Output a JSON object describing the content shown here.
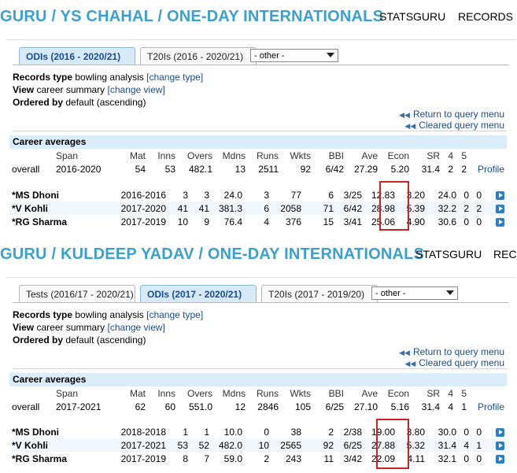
{
  "sections": [
    {
      "header": {
        "title": "GURU / YS CHAHAL / ONE-DAY INTERNATIONALS",
        "nav": [
          "STATSGURU",
          "RECORDS"
        ]
      },
      "tabs": [
        {
          "label": "ODIs (2016 - 2020/21)",
          "active": true
        },
        {
          "label": "T20Is (2016 - 2020/21)",
          "active": false
        }
      ],
      "select": "- other -",
      "records_type": {
        "label": "Records type",
        "value": "bowling analysis",
        "link": "[change type]"
      },
      "view": {
        "label": "View",
        "value": "career summary",
        "link": "[change view]"
      },
      "ordered": {
        "label": "Ordered by",
        "value": "default (ascending)"
      },
      "query_links": [
        "Return to query menu",
        "Cleared query menu"
      ],
      "career_title": "Career averages",
      "columns": [
        "Span",
        "Mat",
        "Inns",
        "Overs",
        "Mdns",
        "Runs",
        "Wkts",
        "BBI",
        "Ave",
        "Econ",
        "SR",
        "4",
        "5"
      ],
      "overall": [
        "overall",
        "2016-2020",
        "54",
        "53",
        "482.1",
        "13",
        "2511",
        "92",
        "6/42",
        "27.29",
        "5.20",
        "31.4",
        "2",
        "2"
      ],
      "profile": "Profile",
      "rows": [
        [
          "*MS Dhoni",
          "2016-2016",
          "3",
          "3",
          "24.0",
          "3",
          "77",
          "6",
          "3/25",
          "12.83",
          "3.20",
          "24.0",
          "0",
          "0"
        ],
        [
          "*V Kohli",
          "2017-2020",
          "41",
          "41",
          "381.3",
          "6",
          "2058",
          "71",
          "6/42",
          "28.98",
          "5.39",
          "32.2",
          "2",
          "2"
        ],
        [
          "*RG Sharma",
          "2017-2019",
          "10",
          "9",
          "76.4",
          "4",
          "376",
          "15",
          "3/41",
          "25.06",
          "4.90",
          "30.6",
          "0",
          "0"
        ]
      ]
    },
    {
      "header": {
        "title": "GURU / KULDEEP YADAV / ONE-DAY INTERNATIONALS",
        "nav": [
          "STATSGURU",
          "RECO"
        ]
      },
      "tabs": [
        {
          "label": "Tests (2016/17 - 2020/21)",
          "active": false
        },
        {
          "label": "ODIs (2017 - 2020/21)",
          "active": true
        },
        {
          "label": "T20Is (2017 - 2019/20)",
          "active": false
        }
      ],
      "select": "- other -",
      "records_type": {
        "label": "Records type",
        "value": "bowling analysis",
        "link": "[change type]"
      },
      "view": {
        "label": "View",
        "value": "career summary",
        "link": "[change view]"
      },
      "ordered": {
        "label": "Ordered by",
        "value": "default (ascending)"
      },
      "query_links": [
        "Return to query menu",
        "Cleared query menu"
      ],
      "career_title": "Career averages",
      "columns": [
        "Span",
        "Mat",
        "Inns",
        "Overs",
        "Mdns",
        "Runs",
        "Wkts",
        "BBI",
        "Ave",
        "Econ",
        "SR",
        "4",
        "5"
      ],
      "overall": [
        "overall",
        "2017-2021",
        "62",
        "60",
        "551.0",
        "12",
        "2846",
        "105",
        "6/25",
        "27.10",
        "5.16",
        "31.4",
        "4",
        "1"
      ],
      "profile": "Profile",
      "rows": [
        [
          "*MS Dhoni",
          "2018-2018",
          "1",
          "1",
          "10.0",
          "0",
          "38",
          "2",
          "2/38",
          "19.00",
          "3.80",
          "30.0",
          "0",
          "0"
        ],
        [
          "*V Kohli",
          "2017-2021",
          "53",
          "52",
          "482.0",
          "10",
          "2565",
          "92",
          "6/25",
          "27.88",
          "5.32",
          "31.4",
          "4",
          "1"
        ],
        [
          "*RG Sharma",
          "2017-2019",
          "8",
          "7",
          "59.0",
          "2",
          "243",
          "11",
          "3/42",
          "22.09",
          "4.11",
          "32.1",
          "0",
          "0"
        ]
      ]
    }
  ]
}
